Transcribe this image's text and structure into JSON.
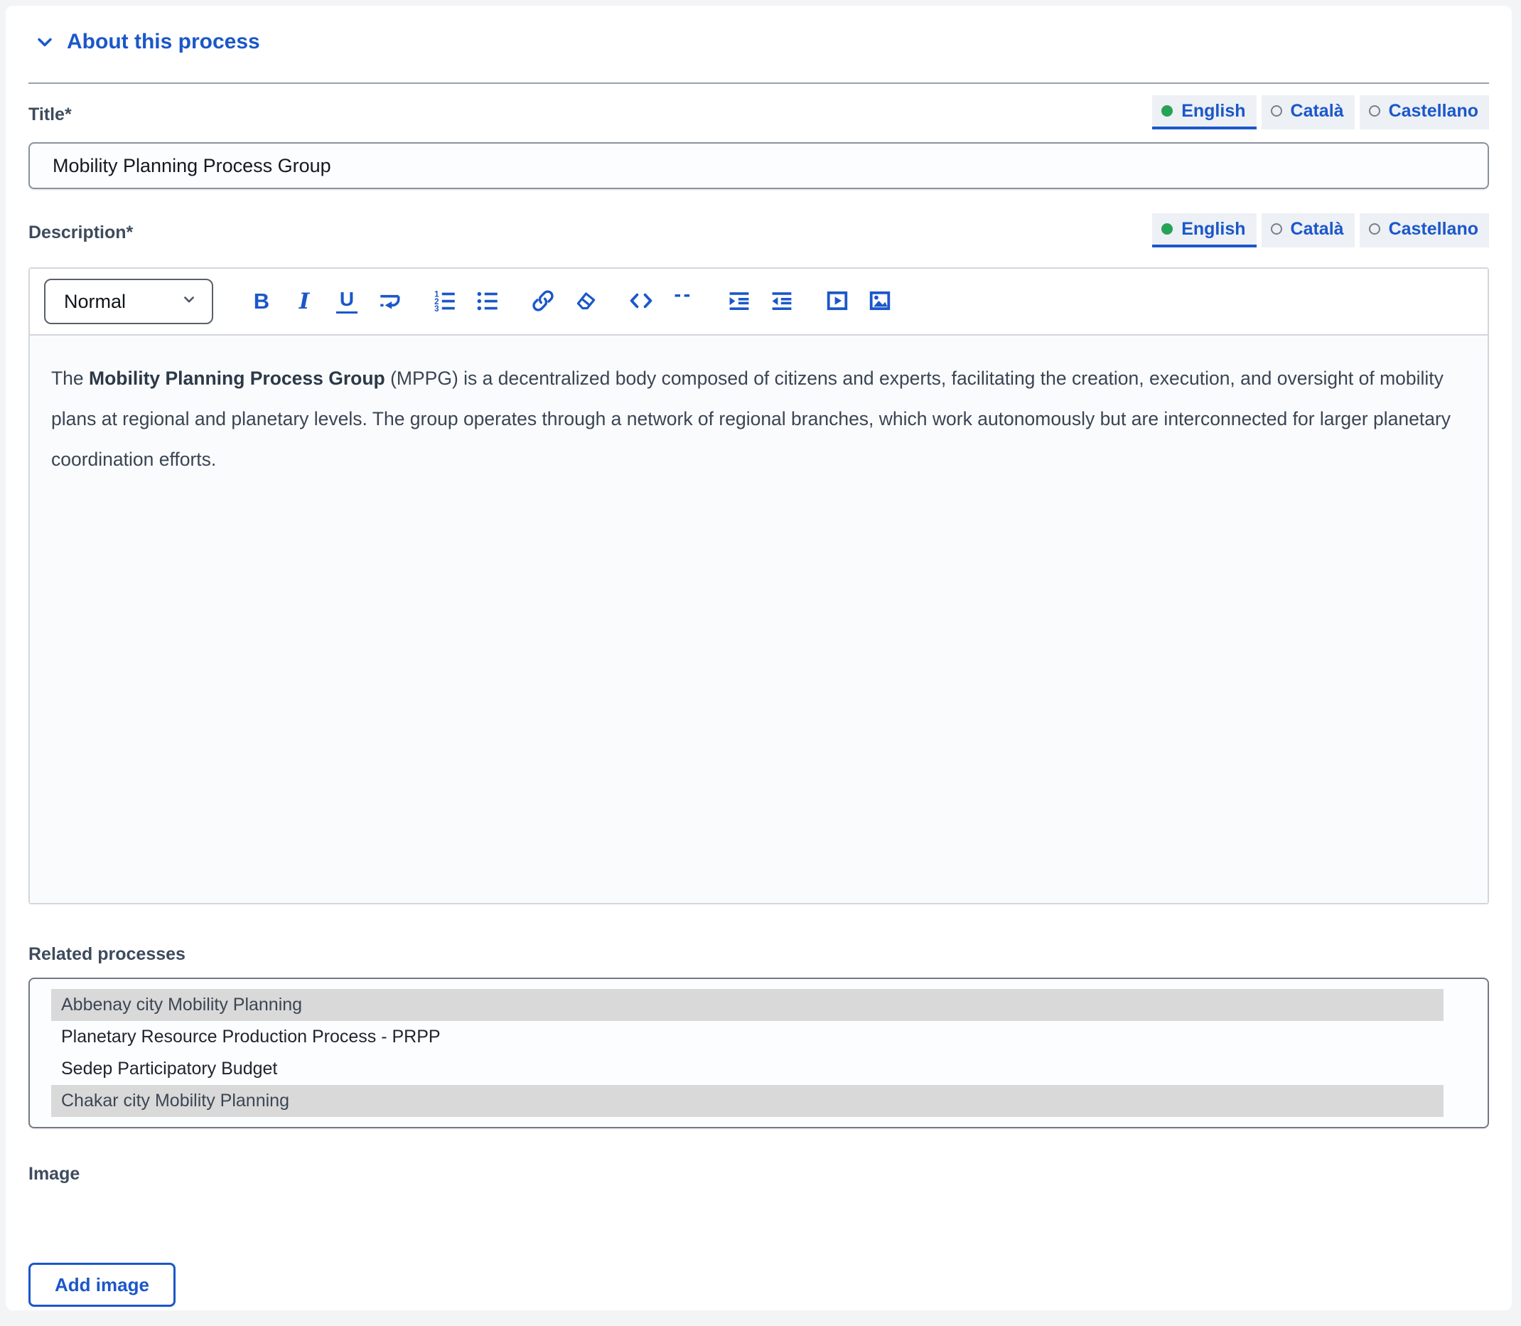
{
  "colors": {
    "primary_blue": "#1b57c9",
    "active_language_dot_green": "#27a356",
    "selected_option_gray": "#d9d9d9",
    "page_background": "#f3f4f6"
  },
  "section": {
    "title": "About this process",
    "chevron_icon": "chevron-down-icon",
    "expanded": true
  },
  "fields": {
    "title": {
      "label": "Title*",
      "value": "Mobility Planning Process Group",
      "languages": [
        {
          "label": "English",
          "active": true
        },
        {
          "label": "Català",
          "active": false
        },
        {
          "label": "Castellano",
          "active": false
        }
      ]
    },
    "description": {
      "label": "Description*",
      "languages": [
        {
          "label": "English",
          "active": true
        },
        {
          "label": "Català",
          "active": false
        },
        {
          "label": "Castellano",
          "active": false
        }
      ],
      "editor": {
        "format_selector": "Normal",
        "toolbar_icons": [
          "bold-icon",
          "italic-icon",
          "underline-icon",
          "line-break-icon",
          "ordered-list-icon",
          "bullet-list-icon",
          "link-icon",
          "clear-format-icon",
          "code-icon",
          "blockquote-icon",
          "indent-icon",
          "outdent-icon",
          "video-icon",
          "image-icon"
        ],
        "content": {
          "text_before_bold": "The ",
          "bold_text": "Mobility Planning Process Group",
          "text_after_bold": " (MPPG) is a decentralized body composed of citizens and experts, facilitating the creation, execution, and oversight of mobility plans at regional and planetary levels. The group operates through a network of regional branches, which work autonomously but are interconnected for larger planetary coordination efforts."
        }
      }
    },
    "related_processes": {
      "label": "Related processes",
      "options": [
        {
          "label": "Abbenay city Mobility Planning",
          "selected": true
        },
        {
          "label": "Planetary Resource Production Process - PRPP",
          "selected": false
        },
        {
          "label": "Sedep Participatory Budget",
          "selected": false
        },
        {
          "label": "Chakar city Mobility Planning",
          "selected": true
        }
      ]
    },
    "image": {
      "label": "Image",
      "add_button_label": "Add image"
    }
  }
}
